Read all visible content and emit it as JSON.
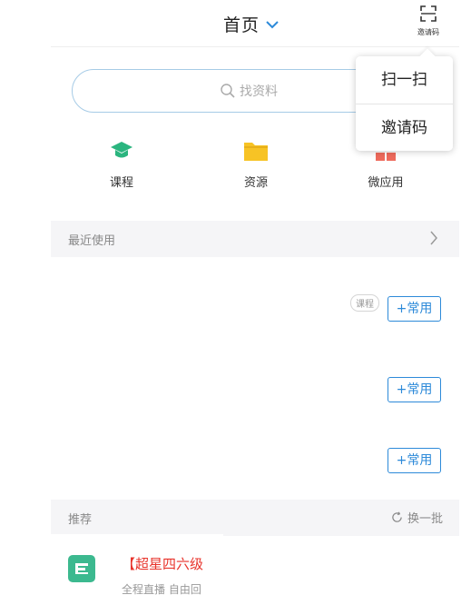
{
  "header": {
    "title": "首页",
    "invite_label": "邀请码"
  },
  "search": {
    "placeholder": "找资料"
  },
  "popup_menu": {
    "items": [
      {
        "label": "扫一扫"
      },
      {
        "label": "邀请码"
      }
    ]
  },
  "categories": [
    {
      "label": "课程",
      "icon": "graduation-cap-icon",
      "color": "#2bb57f"
    },
    {
      "label": "资源",
      "icon": "folder-icon",
      "color": "#f7c325"
    },
    {
      "label": "微应用",
      "icon": "apps-icon",
      "color": "#ee6a5c"
    }
  ],
  "recent": {
    "title": "最近使用",
    "tag_course": "课程",
    "items": [
      {
        "action_label": "+常用"
      },
      {
        "action_label": "+常用"
      },
      {
        "action_label": "+常用"
      }
    ]
  },
  "recommend": {
    "title": "推荐",
    "refresh_label": "换一批",
    "card": {
      "title": "【超星四六级",
      "subtitle": "全程直播  自由回"
    }
  },
  "colors": {
    "accent": "#2d8ad9",
    "search_border": "#a6cbe6",
    "recommend_title": "#e8342c",
    "logo_green": "#3cb98f"
  }
}
